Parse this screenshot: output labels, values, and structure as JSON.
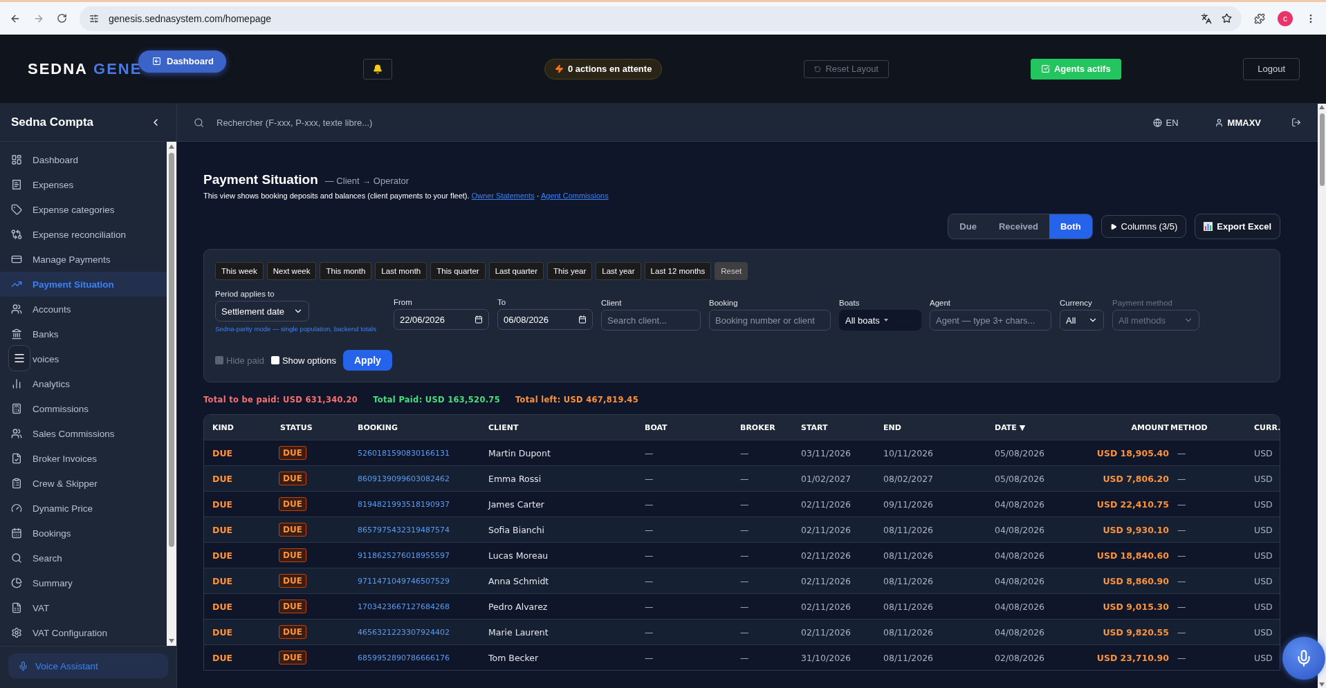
{
  "browser": {
    "url": "genesis.sednasystem.com/homepage",
    "profile": "c"
  },
  "header": {
    "brand": "SEDNA",
    "brand_accent": "GENE",
    "dashboard_button": "Dashboard",
    "pending": "0 actions en attente",
    "reset_layout": "Reset Layout",
    "agents": "Agents actifs",
    "logout": "Logout"
  },
  "sidebar": {
    "title": "Sedna Compta",
    "items": [
      {
        "label": "Dashboard",
        "selected": false
      },
      {
        "label": "Expenses",
        "selected": false
      },
      {
        "label": "Expense categories",
        "selected": false
      },
      {
        "label": "Expense reconciliation",
        "selected": false
      },
      {
        "label": "Manage Payments",
        "selected": false
      },
      {
        "label": "Payment Situation",
        "selected": true
      },
      {
        "label": "Accounts",
        "selected": false
      },
      {
        "label": "Banks",
        "selected": false
      },
      {
        "label": "voices",
        "selected": false
      },
      {
        "label": "Analytics",
        "selected": false
      },
      {
        "label": "Commissions",
        "selected": false
      },
      {
        "label": "Sales Commissions",
        "selected": false
      },
      {
        "label": "Broker Invoices",
        "selected": false
      },
      {
        "label": "Crew & Skipper",
        "selected": false
      },
      {
        "label": "Dynamic Price",
        "selected": false
      },
      {
        "label": "Bookings",
        "selected": false
      },
      {
        "label": "Search",
        "selected": false
      },
      {
        "label": "Summary",
        "selected": false
      },
      {
        "label": "VAT",
        "selected": false
      },
      {
        "label": "VAT Configuration",
        "selected": false
      }
    ],
    "voice_assistant": "Voice Assistant"
  },
  "topbar": {
    "search_placeholder": "Rechercher (F-xxx, P-xxx, texte libre...)",
    "language": "EN",
    "user": "MMAXV"
  },
  "page": {
    "title": "Payment Situation",
    "subtitle": "— Client → Operator",
    "description": "This view shows booking deposits and balances (client payments to your fleet).",
    "links": [
      "Owner Statements",
      "Agent Commissions"
    ],
    "separator": "·"
  },
  "view_toggle": [
    {
      "label": "Due",
      "selected": false
    },
    {
      "label": "Received",
      "selected": false
    },
    {
      "label": "Both",
      "selected": true
    }
  ],
  "columns_button": "Columns (3/5)",
  "export_button": "Export Excel",
  "filters": {
    "presets": [
      {
        "label": "This week",
        "kind": "preset"
      },
      {
        "label": "Next week",
        "kind": "preset"
      },
      {
        "label": "This month",
        "kind": "preset"
      },
      {
        "label": "Last month",
        "kind": "preset"
      },
      {
        "label": "This quarter",
        "kind": "preset"
      },
      {
        "label": "Last quarter",
        "kind": "preset"
      },
      {
        "label": "This year",
        "kind": "preset"
      },
      {
        "label": "Last year",
        "kind": "preset"
      },
      {
        "label": "Last 12 months",
        "kind": "preset"
      },
      {
        "label": "Reset",
        "kind": "reset"
      }
    ],
    "period": {
      "label": "Period applies to",
      "value": "Settlement date",
      "note": "Sedna-parity mode — single population, backend totals"
    },
    "fields": [
      {
        "kind": "date",
        "label": "From",
        "value": "22/06/2026",
        "disabled": false
      },
      {
        "kind": "date",
        "label": "To",
        "value": "06/08/2026",
        "disabled": false
      },
      {
        "kind": "text",
        "label": "Client",
        "placeholder": "Search client...",
        "disabled": false
      },
      {
        "kind": "text",
        "label": "Booking",
        "placeholder": "Booking number or client",
        "disabled": false
      },
      {
        "kind": "dropdown",
        "label": "Boats",
        "value": "All boats",
        "disabled": false
      },
      {
        "kind": "text",
        "label": "Agent",
        "placeholder": "Agent — type 3+ chars...",
        "disabled": false
      },
      {
        "kind": "select",
        "label": "Currency",
        "value": "All",
        "disabled": false
      },
      {
        "kind": "select",
        "label": "Payment method",
        "value": "All methods",
        "disabled": true
      }
    ],
    "checkboxes": [
      {
        "label": "Hide paid",
        "checked": false,
        "disabled": true
      },
      {
        "label": "Show options",
        "checked": false,
        "disabled": false
      }
    ],
    "apply": "Apply"
  },
  "totals": [
    {
      "text": "Total to be paid: USD 631,340.20",
      "color": "#f87171"
    },
    {
      "text": "Total Paid: USD 163,520.75",
      "color": "#4ade80"
    },
    {
      "text": "Total left: USD 467,819.45",
      "color": "#fb923c"
    }
  ],
  "table": {
    "columns": [
      "KIND",
      "STATUS",
      "BOOKING",
      "CLIENT",
      "BOAT",
      "BROKER",
      "START",
      "END",
      "DATE ▼",
      "AMOUNT",
      "METHOD",
      "CURR."
    ],
    "rows": [
      [
        "DUE",
        "DUE",
        "5260181590830166131",
        "Martin Dupont",
        "—",
        "—",
        "03/11/2026",
        "10/11/2026",
        "05/08/2026",
        "USD 18,905.40",
        "—",
        "USD"
      ],
      [
        "DUE",
        "DUE",
        "8609139099603082462",
        "Emma Rossi",
        "—",
        "—",
        "01/02/2027",
        "08/02/2027",
        "05/08/2026",
        "USD 7,806.20",
        "—",
        "USD"
      ],
      [
        "DUE",
        "DUE",
        "8194821993518190937",
        "James Carter",
        "—",
        "—",
        "02/11/2026",
        "09/11/2026",
        "04/08/2026",
        "USD 22,410.75",
        "—",
        "USD"
      ],
      [
        "DUE",
        "DUE",
        "8657975432319487574",
        "Sofia Bianchi",
        "—",
        "—",
        "02/11/2026",
        "08/11/2026",
        "04/08/2026",
        "USD 9,930.10",
        "—",
        "USD"
      ],
      [
        "DUE",
        "DUE",
        "9118625276018955597",
        "Lucas Moreau",
        "—",
        "—",
        "02/11/2026",
        "08/11/2026",
        "04/08/2026",
        "USD 18,840.60",
        "—",
        "USD"
      ],
      [
        "DUE",
        "DUE",
        "9711471049746507529",
        "Anna Schmidt",
        "—",
        "—",
        "02/11/2026",
        "08/11/2026",
        "04/08/2026",
        "USD 8,860.90",
        "—",
        "USD"
      ],
      [
        "DUE",
        "DUE",
        "1703423667127684268",
        "Pedro Alvarez",
        "—",
        "—",
        "02/11/2026",
        "08/11/2026",
        "04/08/2026",
        "USD 9,015.30",
        "—",
        "USD"
      ],
      [
        "DUE",
        "DUE",
        "4656321223307924402",
        "Marie Laurent",
        "—",
        "—",
        "02/11/2026",
        "08/11/2026",
        "04/08/2026",
        "USD 9,820.55",
        "—",
        "USD"
      ],
      [
        "DUE",
        "DUE",
        "6859952890786666176",
        "Tom Becker",
        "—",
        "—",
        "31/10/2026",
        "08/11/2026",
        "02/08/2026",
        "USD 23,710.90",
        "—",
        "USD"
      ]
    ]
  }
}
